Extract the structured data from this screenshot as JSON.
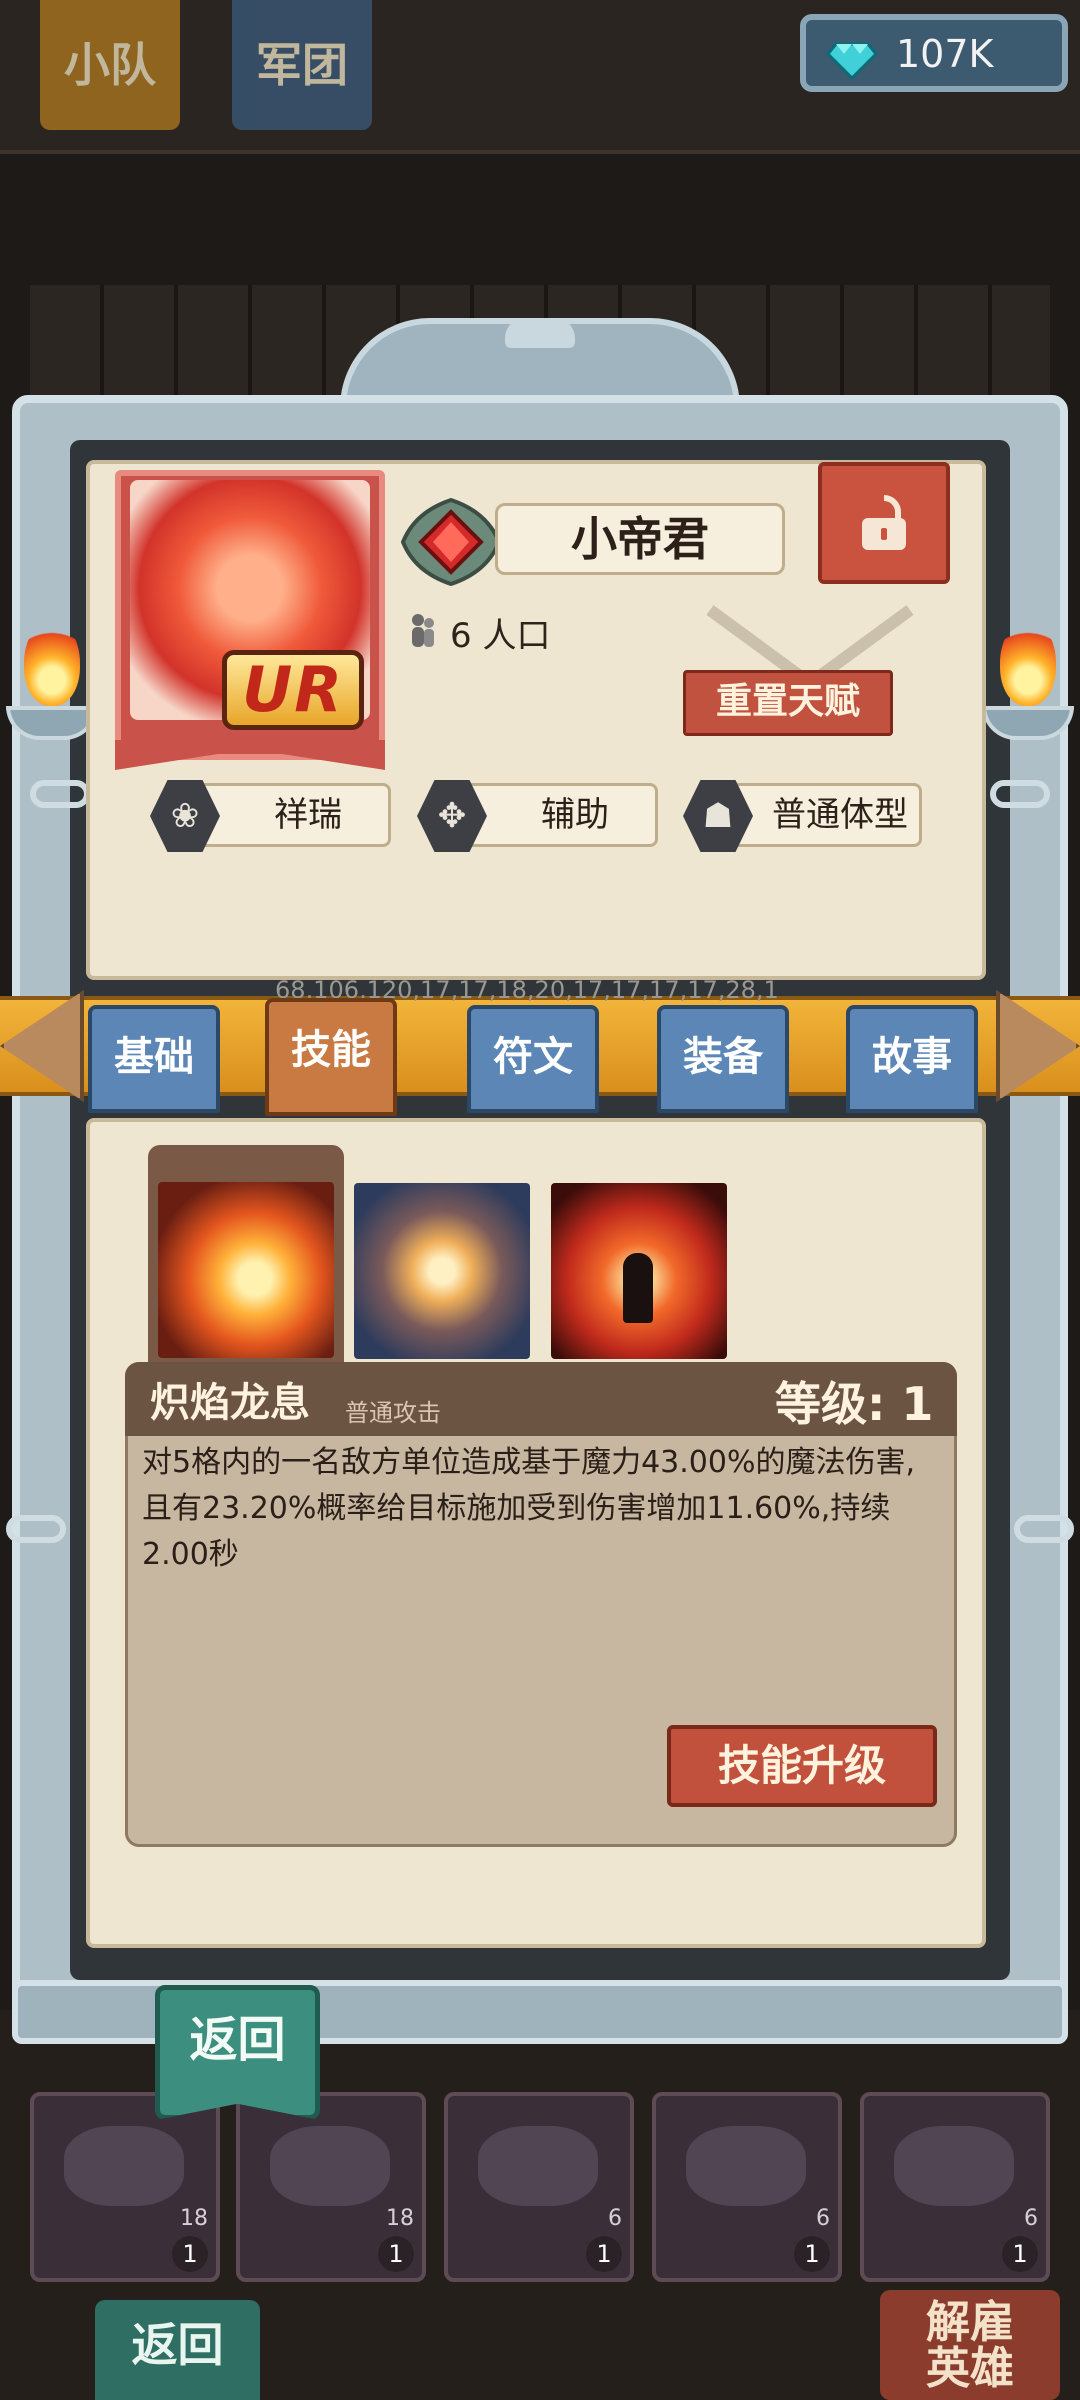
{
  "header": {
    "tabs": [
      {
        "label": "小队"
      },
      {
        "label": "军团"
      }
    ],
    "currency": {
      "icon": "diamond-icon",
      "value": "107K",
      "color": "#3fd0d8"
    }
  },
  "hero": {
    "name": "小帝君",
    "rarity": "UR",
    "population": "6 人口",
    "reset_talent_label": "重置天赋",
    "lock_icon": "unlock-icon",
    "tags": [
      {
        "icon": "auspicious-icon",
        "label": "祥瑞"
      },
      {
        "icon": "support-icon",
        "label": "辅助"
      },
      {
        "icon": "body-type-icon",
        "label": "普通体型"
      }
    ],
    "debug_text": "68,106,120,17,17,18,20,17,17,17,17,28,1"
  },
  "tabs": [
    {
      "label": "基础",
      "active": false
    },
    {
      "label": "技能",
      "active": true
    },
    {
      "label": "符文",
      "active": false
    },
    {
      "label": "装备",
      "active": false
    },
    {
      "label": "故事",
      "active": false
    }
  ],
  "skill": {
    "name": "炽焰龙息",
    "type": "普通攻击",
    "level": "等级: 1",
    "description": "对5格内的一名敌方单位造成基于魔力43.00%的魔法伤害,且有23.20%概率给目标施加受到伤害增加11.60%,持续2.00秒",
    "upgrade_label": "技能升级"
  },
  "back_label": "返回",
  "background": {
    "back_label": "返回",
    "dismiss_line1": "解雇",
    "dismiss_line2": "英雄",
    "unit_cards": [
      {
        "pop": "18",
        "level": "1"
      },
      {
        "pop": "18",
        "level": "1"
      },
      {
        "pop": "6",
        "level": "1"
      },
      {
        "pop": "6",
        "level": "1"
      },
      {
        "pop": "6",
        "level": "1"
      }
    ]
  },
  "colors": {
    "accent_gold": "#e9a52a",
    "tab_blue": "#5b86b6",
    "tab_active": "#c97a43",
    "button_red": "#c1513d",
    "back_teal": "#3c8f7e"
  }
}
